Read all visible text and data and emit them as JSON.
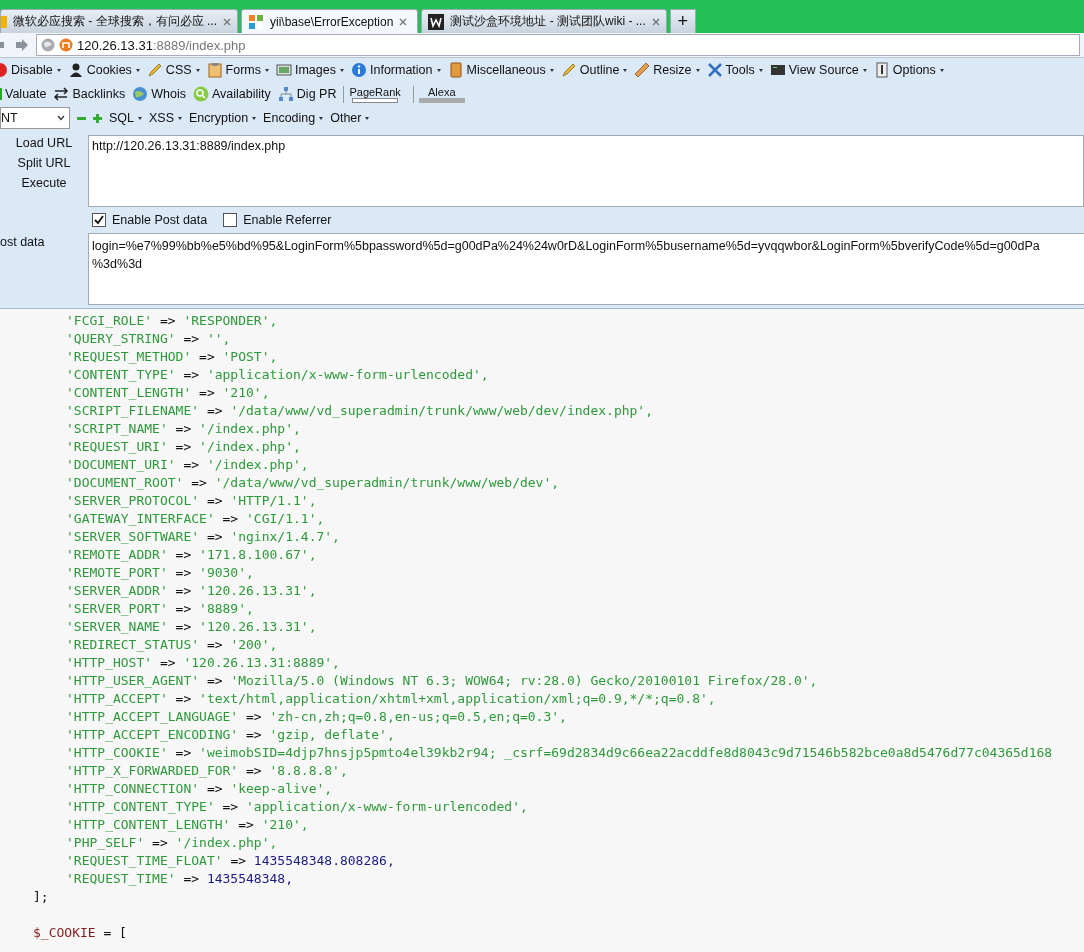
{
  "tabs": [
    {
      "title": "微软必应搜索 - 全球搜索，有问必应 ...",
      "selected": false
    },
    {
      "title": "yii\\base\\ErrorException",
      "selected": true
    },
    {
      "title": "测试沙盒环境地址 - 测试团队wiki - ...",
      "selected": false
    }
  ],
  "new_tab": "+",
  "address": {
    "host": "120.26.13.31",
    "rest": ":8889/index.php"
  },
  "toolbar_rows": [
    [
      {
        "label": "Disable",
        "menu": true
      },
      {
        "label": "Cookies",
        "menu": true
      },
      {
        "label": "CSS",
        "menu": true
      },
      {
        "label": "Forms",
        "menu": true
      },
      {
        "label": "Images",
        "menu": true
      },
      {
        "label": "Information",
        "menu": true
      },
      {
        "label": "Miscellaneous",
        "menu": true
      },
      {
        "label": "Outline",
        "menu": true
      },
      {
        "label": "Resize",
        "menu": true
      },
      {
        "label": "Tools",
        "menu": true
      },
      {
        "label": "View Source",
        "menu": true
      },
      {
        "label": "Options",
        "menu": true
      }
    ],
    [
      {
        "label": "Valuate",
        "menu": false,
        "kind": "button"
      },
      {
        "label": "Backlinks",
        "menu": false,
        "kind": "button"
      },
      {
        "label": "Whois",
        "menu": false,
        "kind": "button"
      },
      {
        "label": "Availability",
        "menu": false,
        "kind": "button"
      },
      {
        "label": "Dig PR",
        "menu": false,
        "kind": "button"
      },
      {
        "label": "PageRank",
        "menu": false,
        "kind": "rank"
      },
      {
        "label": "Alexa",
        "menu": false,
        "kind": "rank"
      }
    ]
  ],
  "hackbar": {
    "select": "NT",
    "menus": [
      {
        "label": "SQL"
      },
      {
        "label": "XSS"
      },
      {
        "label": "Encryption"
      },
      {
        "label": "Encoding"
      },
      {
        "label": "Other"
      }
    ],
    "actions": [
      {
        "label": "Load URL"
      },
      {
        "label": "Split URL"
      },
      {
        "label": "Execute"
      }
    ],
    "url": "http://120.26.13.31:8889/index.php",
    "options": [
      {
        "label": "Enable Post data",
        "checked": true
      },
      {
        "label": "Enable Referrer",
        "checked": false
      }
    ],
    "post_label": "ost data",
    "post_lines": [
      "login=%e7%99%bb%e5%bd%95&LoginForm%5bpassword%5d=g00dPa%24%24w0rD&LoginForm%5busername%5d=yvqqwbor&LoginForm%5bverifyCode%5d=g00dPa",
      "%3d%3d"
    ]
  },
  "code_lines": [
    {
      "kind": "string",
      "key": "'FCGI_ROLE'",
      "op": "=>",
      "value": "'RESPONDER',"
    },
    {
      "kind": "string",
      "key": "'QUERY_STRING'",
      "op": "=>",
      "value": "'',"
    },
    {
      "kind": "string",
      "key": "'REQUEST_METHOD'",
      "op": "=>",
      "value": "'POST',"
    },
    {
      "kind": "string",
      "key": "'CONTENT_TYPE'",
      "op": "=>",
      "value": "'application/x-www-form-urlencoded',"
    },
    {
      "kind": "string",
      "key": "'CONTENT_LENGTH'",
      "op": "=>",
      "value": "'210',"
    },
    {
      "kind": "string",
      "key": "'SCRIPT_FILENAME'",
      "op": "=>",
      "value": "'/data/www/vd_superadmin/trunk/www/web/dev/index.php',"
    },
    {
      "kind": "string",
      "key": "'SCRIPT_NAME'",
      "op": "=>",
      "value": "'/index.php',"
    },
    {
      "kind": "string",
      "key": "'REQUEST_URI'",
      "op": "=>",
      "value": "'/index.php',"
    },
    {
      "kind": "string",
      "key": "'DOCUMENT_URI'",
      "op": "=>",
      "value": "'/index.php',"
    },
    {
      "kind": "string",
      "key": "'DOCUMENT_ROOT'",
      "op": "=>",
      "value": "'/data/www/vd_superadmin/trunk/www/web/dev',"
    },
    {
      "kind": "string",
      "key": "'SERVER_PROTOCOL'",
      "op": "=>",
      "value": "'HTTP/1.1',"
    },
    {
      "kind": "string",
      "key": "'GATEWAY_INTERFACE'",
      "op": "=>",
      "value": "'CGI/1.1',"
    },
    {
      "kind": "string",
      "key": "'SERVER_SOFTWARE'",
      "op": "=>",
      "value": "'nginx/1.4.7',"
    },
    {
      "kind": "string",
      "key": "'REMOTE_ADDR'",
      "op": "=>",
      "value": "'171.8.100.67',"
    },
    {
      "kind": "string",
      "key": "'REMOTE_PORT'",
      "op": "=>",
      "value": "'9030',"
    },
    {
      "kind": "string",
      "key": "'SERVER_ADDR'",
      "op": "=>",
      "value": "'120.26.13.31',"
    },
    {
      "kind": "string",
      "key": "'SERVER_PORT'",
      "op": "=>",
      "value": "'8889',"
    },
    {
      "kind": "string",
      "key": "'SERVER_NAME'",
      "op": "=>",
      "value": "'120.26.13.31',"
    },
    {
      "kind": "string",
      "key": "'REDIRECT_STATUS'",
      "op": "=>",
      "value": "'200',"
    },
    {
      "kind": "string",
      "key": "'HTTP_HOST'",
      "op": "=>",
      "value": "'120.26.13.31:8889',"
    },
    {
      "kind": "string",
      "key": "'HTTP_USER_AGENT'",
      "op": "=>",
      "value": "'Mozilla/5.0 (Windows NT 6.3; WOW64; rv:28.0) Gecko/20100101 Firefox/28.0',"
    },
    {
      "kind": "string",
      "key": "'HTTP_ACCEPT'",
      "op": "=>",
      "value": "'text/html,application/xhtml+xml,application/xml;q=0.9,*/*;q=0.8',"
    },
    {
      "kind": "string",
      "key": "'HTTP_ACCEPT_LANGUAGE'",
      "op": "=>",
      "value": "'zh-cn,zh;q=0.8,en-us;q=0.5,en;q=0.3',"
    },
    {
      "kind": "string",
      "key": "'HTTP_ACCEPT_ENCODING'",
      "op": "=>",
      "value": "'gzip, deflate',"
    },
    {
      "kind": "string",
      "key": "'HTTP_COOKIE'",
      "op": "=>",
      "value": "'weimobSID=4djp7hnsjp5pmto4el39kb2r94; _csrf=69d2834d9c66ea22acddfe8d8043c9d71546b582bce0a8d5476d77c04365d168"
    },
    {
      "kind": "string",
      "key": "'HTTP_X_FORWARDED_FOR'",
      "op": "=>",
      "value": "'8.8.8.8',"
    },
    {
      "kind": "string",
      "key": "'HTTP_CONNECTION'",
      "op": "=>",
      "value": "'keep-alive',"
    },
    {
      "kind": "string",
      "key": "'HTTP_CONTENT_TYPE'",
      "op": "=>",
      "value": "'application/x-www-form-urlencoded',"
    },
    {
      "kind": "string",
      "key": "'HTTP_CONTENT_LENGTH'",
      "op": "=>",
      "value": "'210',"
    },
    {
      "kind": "string",
      "key": "'PHP_SELF'",
      "op": "=>",
      "value": "'/index.php',"
    },
    {
      "kind": "number",
      "key": "'REQUEST_TIME_FLOAT'",
      "op": "=>",
      "value": "1435548348.808286,"
    },
    {
      "kind": "number",
      "key": "'REQUEST_TIME'",
      "op": "=>",
      "value": "1435548348,"
    },
    {
      "kind": "close",
      "text": "];"
    },
    {
      "kind": "assign",
      "var": "$_COOKIE",
      "op": "= ["
    }
  ]
}
